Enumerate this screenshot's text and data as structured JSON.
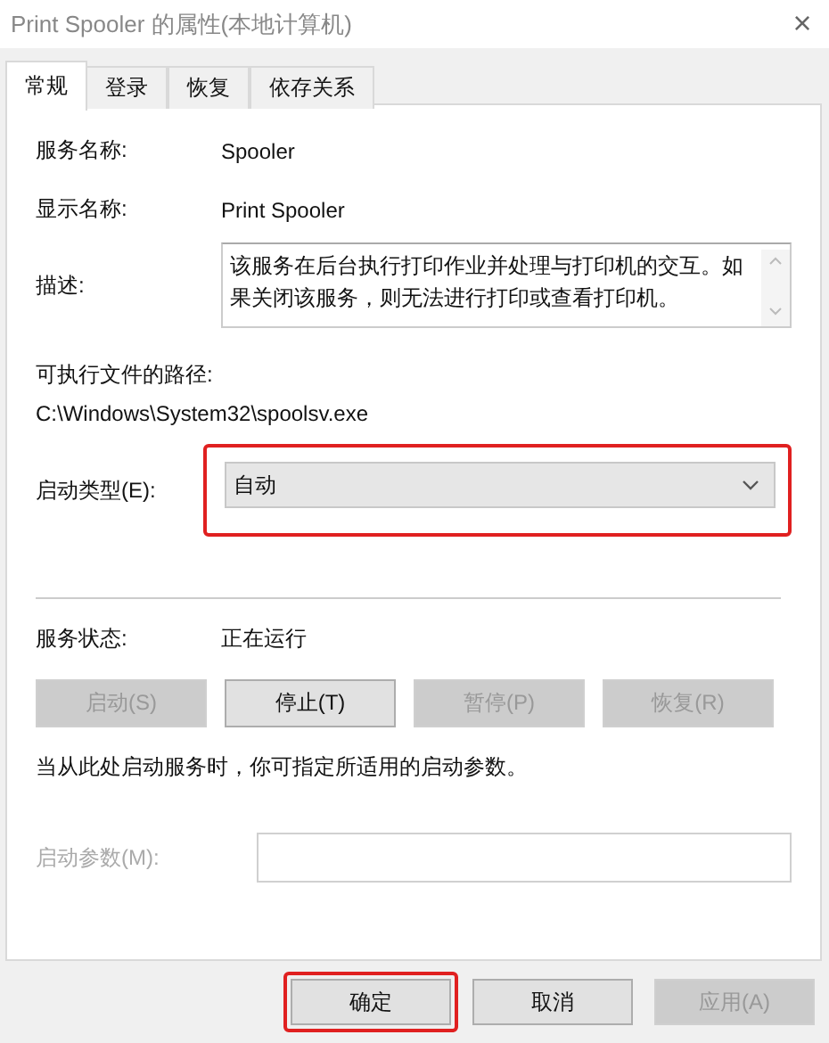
{
  "window": {
    "title": "Print Spooler 的属性(本地计算机)",
    "close": "×"
  },
  "tabs": [
    {
      "label": "常规",
      "selected": true
    },
    {
      "label": "登录",
      "selected": false
    },
    {
      "label": "恢复",
      "selected": false
    },
    {
      "label": "依存关系",
      "selected": false
    }
  ],
  "service_name": {
    "label": "服务名称:",
    "value": "Spooler"
  },
  "display_name": {
    "label": "显示名称:",
    "value": "Print Spooler"
  },
  "description": {
    "label": "描述:",
    "value": "该服务在后台执行打印作业并处理与打印机的交互。如果关闭该服务，则无法进行打印或查看打印机。"
  },
  "executable_path": {
    "label": "可执行文件的路径:",
    "value": "C:\\Windows\\System32\\spoolsv.exe"
  },
  "startup_type": {
    "label": "启动类型(E):",
    "value": "自动",
    "highlighted": true
  },
  "service_status": {
    "label": "服务状态:",
    "value": "正在运行"
  },
  "service_buttons": [
    {
      "label": "启动(S)",
      "disabled": true
    },
    {
      "label": "停止(T)",
      "disabled": false
    },
    {
      "label": "暂停(P)",
      "disabled": true
    },
    {
      "label": "恢复(R)",
      "disabled": true
    }
  ],
  "hint": "当从此处启动服务时，你可指定所适用的启动参数。",
  "start_parameters": {
    "label": "启动参数(M):",
    "disabled": true
  },
  "dialog_buttons": [
    {
      "label": "确定",
      "disabled": false,
      "highlighted": true
    },
    {
      "label": "取消",
      "disabled": false,
      "highlighted": false
    },
    {
      "label": "应用(A)",
      "disabled": true,
      "highlighted": false
    }
  ]
}
